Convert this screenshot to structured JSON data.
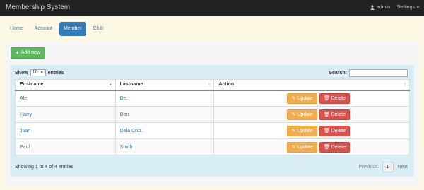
{
  "navbar": {
    "brand": "Membership System",
    "user": "admin",
    "settings": "Settings",
    "user_icon": "user-icon",
    "caret_icon": "caret-down-icon"
  },
  "tabs": [
    {
      "label": "Home",
      "active": false
    },
    {
      "label": "Account",
      "active": false
    },
    {
      "label": "Member",
      "active": true
    },
    {
      "label": "Club",
      "active": false
    }
  ],
  "toolbar": {
    "add_label": "Add new",
    "add_icon": "plus-icon"
  },
  "datatable": {
    "show_label": "Show",
    "page_size": "10",
    "entries_label": "entries",
    "search_label": "Search:",
    "search_value": "",
    "columns": [
      "Firstname",
      "Lastname",
      "Action"
    ],
    "rows": [
      {
        "firstname": "Ale",
        "lastname": "De."
      },
      {
        "firstname": "Harry",
        "lastname": "Den"
      },
      {
        "firstname": "Juan",
        "lastname": "Dela Cruz."
      },
      {
        "firstname": "Paul",
        "lastname": "Smith"
      }
    ],
    "update_label": "Update",
    "delete_label": "Delete",
    "info": "Showing 1 to 4 of 4 entries",
    "pagination": {
      "previous": "Previous",
      "current": "1",
      "next": "Next"
    }
  },
  "colors": {
    "navbar": "#222222",
    "primary": "#337ab7",
    "success": "#5cb85c",
    "warning": "#f0ad4e",
    "danger": "#d9534f",
    "panel": "#d9edf7",
    "background": "#fcf8e3"
  }
}
